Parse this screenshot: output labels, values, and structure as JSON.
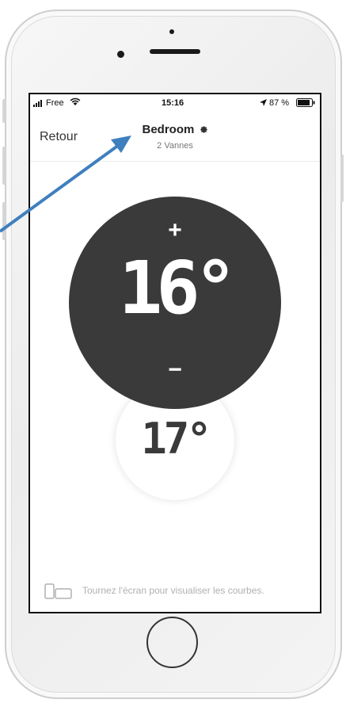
{
  "status_bar": {
    "carrier": "Free",
    "time": "15:16",
    "battery": "87 %",
    "icons": [
      "signal-icon",
      "wifi-icon",
      "location-icon",
      "battery-icon"
    ]
  },
  "nav": {
    "back_label": "Retour",
    "title": "Bedroom",
    "subtitle": "2 Vannes",
    "settings_icon": "gear-icon"
  },
  "thermostat": {
    "setpoint": "16°",
    "current": "17°",
    "increase_label": "+",
    "decrease_label": "−",
    "dial_color": "#3a3a3a"
  },
  "hint": {
    "text": "Tournez l'écran pour visualiser les courbes.",
    "icon": "rotate-devices-icon"
  },
  "annotation": {
    "arrow_color": "#3f7fbf"
  }
}
